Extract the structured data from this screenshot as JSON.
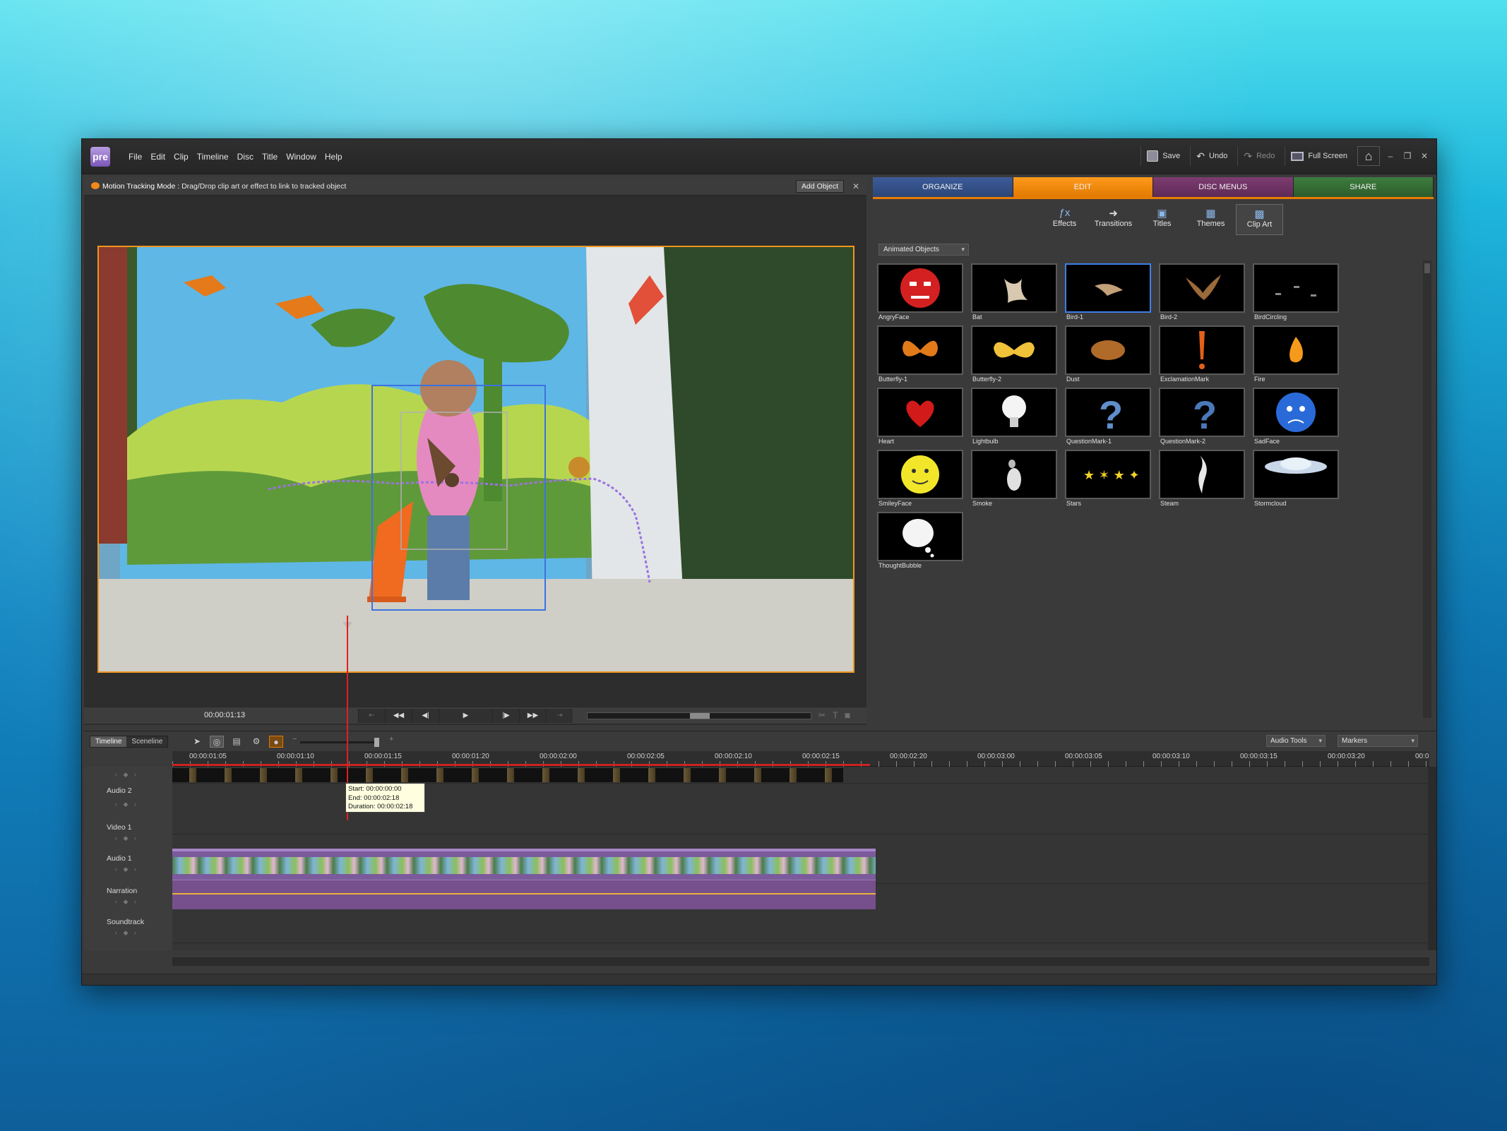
{
  "app": {
    "logo": "pre",
    "menu": [
      "File",
      "Edit",
      "Clip",
      "Timeline",
      "Disc",
      "Title",
      "Window",
      "Help"
    ],
    "toolbar": {
      "save": "Save",
      "undo": "Undo",
      "redo": "Redo",
      "fullscreen": "Full Screen"
    }
  },
  "monitor": {
    "mode_label": "Motion Tracking Mode :",
    "mode_hint": "Drag/Drop clip art or effect to link to tracked object",
    "add_object": "Add Object",
    "timecode": "00:00:01:13"
  },
  "panel": {
    "tabs": [
      "ORGANIZE",
      "EDIT",
      "DISC MENUS",
      "SHARE"
    ],
    "tools": [
      "Effects",
      "Transitions",
      "Titles",
      "Themes",
      "Clip Art"
    ],
    "category": "Animated Objects",
    "items": [
      "AngryFace",
      "Bat",
      "Bird-1",
      "Bird-2",
      "BirdCircling",
      "Butterfly-1",
      "Butterfly-2",
      "Dust",
      "ExclamationMark",
      "Fire",
      "Heart",
      "Lightbulb",
      "QuestionMark-1",
      "QuestionMark-2",
      "SadFace",
      "SmileyFace",
      "Smoke",
      "Stars",
      "Steam",
      "Stormcloud",
      "ThoughtBubble"
    ],
    "selected": "Bird-1"
  },
  "timeline": {
    "tabs": [
      "Timeline",
      "Sceneline"
    ],
    "audio_tools": "Audio Tools",
    "markers": "Markers",
    "ruler": [
      "00:00:01:05",
      "00:00:01:10",
      "00:00:01:15",
      "00:00:01:20",
      "00:00:02:00",
      "00:00:02:05",
      "00:00:02:10",
      "00:00:02:15",
      "00:00:02:20",
      "00:00:03:00",
      "00:00:03:05",
      "00:00:03:10",
      "00:00:03:15",
      "00:00:03:20",
      "00:0"
    ],
    "tracks": [
      "Audio 2",
      "Video 1",
      "Audio 1",
      "Narration",
      "Soundtrack"
    ],
    "tooltip": {
      "start": "Start: 00:00:00:00",
      "end": "End: 00:00:02:18",
      "duration": "Duration: 00:00:02:18"
    }
  },
  "colors": {
    "edit_accent": "#e97d00",
    "organize": "#2b4678",
    "disc": "#5e2a56",
    "share": "#2c5c2c",
    "track_path": "#8e6ad6",
    "selection": "#3f7fe8"
  }
}
